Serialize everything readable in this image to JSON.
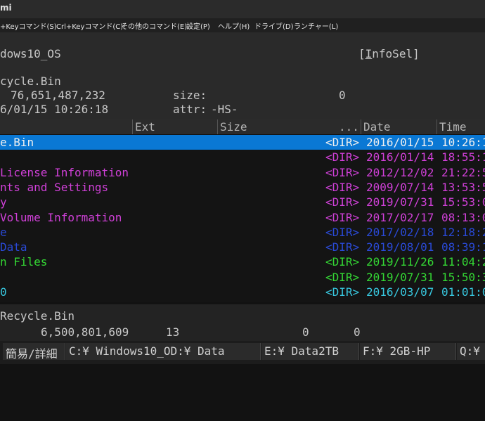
{
  "window": {
    "title": "mi"
  },
  "menu": [
    "+Keyコマンド(S)",
    "Crl+Keyコマンド(C)",
    "その他のコマンド(E)",
    "設定(P)",
    "ヘルプ(H)",
    "ドライブ(D)",
    "ランチャー(L)"
  ],
  "info": {
    "volume": "dows10_OS",
    "infosel_prefix": "[",
    "infosel_hotkey": "I",
    "infosel_rest": "nfoSel]",
    "name": "cycle.Bin",
    "number": "76,651,487,232",
    "size_label": "size:",
    "size_value": "0",
    "datetime": "6/01/15 10:26:18",
    "attr_label": "attr:",
    "attr_value": "-HS-"
  },
  "columns": {
    "ext": "Ext",
    "size": "Size",
    "dots": "...",
    "date": "Date",
    "time": "Time"
  },
  "colors": {
    "selected_bg": "#0a78d4",
    "white": "#f0f0f0",
    "magenta": "#d040d8",
    "blue": "#2a4ad8",
    "green": "#34d834",
    "cyan": "#38c8e0"
  },
  "files": [
    {
      "name": "e.Bin",
      "dir": "<DIR>",
      "date": "2016/01/15",
      "time": "10:26:1",
      "color": "white",
      "selected": true
    },
    {
      "name": "",
      "dir": "<DIR>",
      "date": "2016/01/14",
      "time": "18:55:1",
      "color": "magenta"
    },
    {
      "name": "License Information",
      "dir": "<DIR>",
      "date": "2012/12/02",
      "time": "21:22:5",
      "color": "magenta"
    },
    {
      "name": "nts and Settings",
      "dir": "<DIR>",
      "date": "2009/07/14",
      "time": "13:53:5",
      "color": "magenta"
    },
    {
      "name": "y",
      "dir": "<DIR>",
      "date": "2019/07/31",
      "time": "15:53:0",
      "color": "magenta"
    },
    {
      "name": "Volume Information",
      "dir": "<DIR>",
      "date": "2017/02/17",
      "time": "08:13:0",
      "color": "magenta"
    },
    {
      "name": "e",
      "dir": "<DIR>",
      "date": "2017/02/18",
      "time": "12:18:2",
      "color": "blue"
    },
    {
      "name": "Data",
      "dir": "<DIR>",
      "date": "2019/08/01",
      "time": "08:39:1",
      "color": "blue"
    },
    {
      "name": "n Files",
      "dir": "<DIR>",
      "date": "2019/11/26",
      "time": "11:04:2",
      "color": "green"
    },
    {
      "name": "",
      "dir": "<DIR>",
      "date": "2019/07/31",
      "time": "15:50:3",
      "color": "green"
    },
    {
      "name": "0",
      "dir": "<DIR>",
      "date": "2016/03/07",
      "time": "01:01:0",
      "color": "cyan"
    }
  ],
  "bottom": {
    "path": "Recycle.Bin",
    "size_total": "6,500,801,609",
    "count": "13",
    "zero1": "0",
    "zero2": "0"
  },
  "drives": [
    {
      "label": "簡易/詳細"
    },
    {
      "label": "C:¥ Windows10_OD:¥ Data"
    },
    {
      "label": "E:¥ Data2TB"
    },
    {
      "label": "F:¥ 2GB-HP"
    },
    {
      "label": "Q:¥"
    }
  ]
}
